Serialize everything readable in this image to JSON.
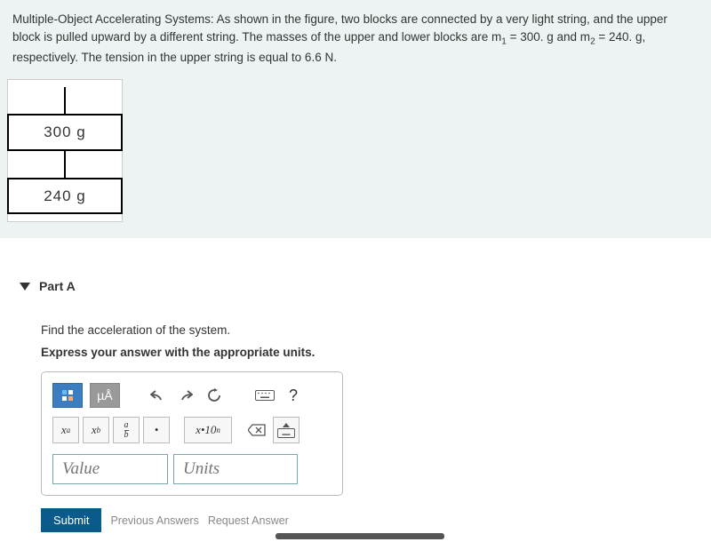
{
  "problem": {
    "text_prefix": "Multiple-Object Accelerating Systems: As shown in the figure, two blocks are connected by a very light string, and the upper block is pulled upward by a different string. The masses of the upper and lower blocks are m",
    "sub1": "1",
    "text_mid1": " = 300. g and m",
    "sub2": "2",
    "text_mid2": " = 240. g, respectively.  The tension in the upper string is equal to 6.6 N."
  },
  "figure": {
    "block1": "300 g",
    "block2": "240 g"
  },
  "part": {
    "label": "Part A",
    "question": "Find the acceleration of the system.",
    "instruction": "Express your answer with the appropriate units."
  },
  "toolbar": {
    "units_label": "µÅ",
    "undo": "↶",
    "redo": "↷",
    "reset": "↺",
    "keyboard": "⌨",
    "help": "?",
    "superscript": "xᵃ",
    "subscript": "x_b",
    "fraction": "a/b",
    "dot": "•",
    "sci": "x·10ⁿ",
    "backspace": "⌫",
    "kbd2": "⌨"
  },
  "inputs": {
    "value_placeholder": "Value",
    "units_placeholder": "Units"
  },
  "actions": {
    "submit": "Submit",
    "previous": "Previous Answers",
    "request": "Request Answer"
  }
}
